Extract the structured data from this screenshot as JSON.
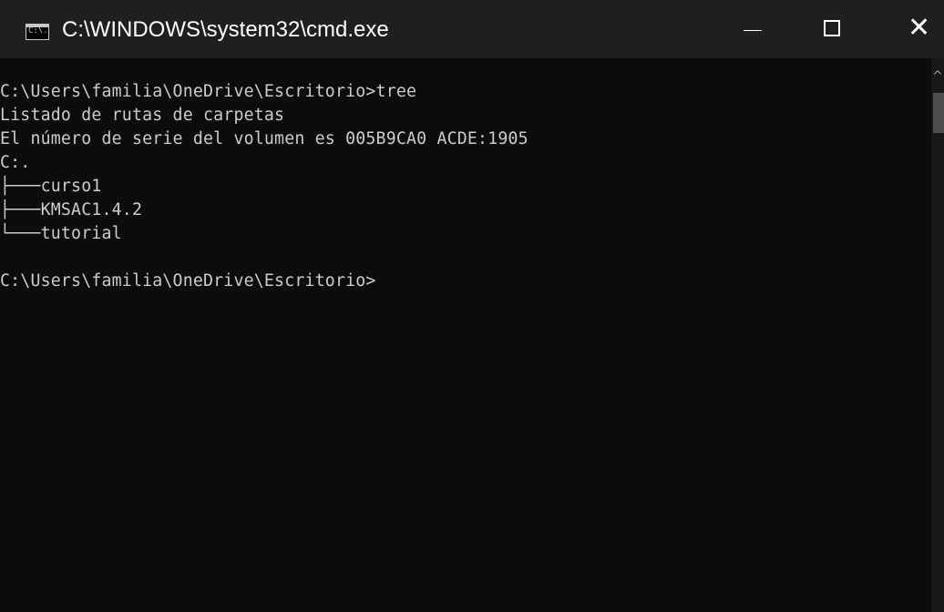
{
  "window": {
    "title": "C:\\WINDOWS\\system32\\cmd.exe",
    "icon": "cmd-icon",
    "icon_label": "C:\\.",
    "controls": {
      "minimize": "minimize-icon",
      "maximize": "maximize-icon",
      "close": "close-icon",
      "close_glyph": "✕"
    }
  },
  "console": {
    "lines": [
      "C:\\Users\\familia\\OneDrive\\Escritorio>tree",
      "Listado de rutas de carpetas",
      "El número de serie del volumen es 005B9CA0 ACDE:1905",
      "C:.",
      "├───curso1",
      "├───KMSAC1.4.2",
      "└───tutorial",
      "",
      "C:\\Users\\familia\\OneDrive\\Escritorio>"
    ],
    "colors": {
      "background": "#0c0c0c",
      "text": "#cccccc",
      "titlebar": "#1f1f1f"
    }
  },
  "scrollbar": {
    "up_arrow": "^"
  }
}
